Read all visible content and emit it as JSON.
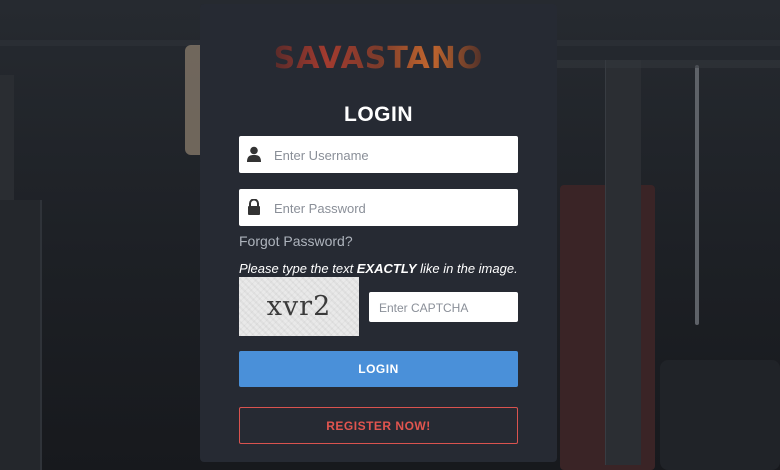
{
  "brand": {
    "logo_text": "SAVASTANO"
  },
  "form": {
    "title": "LOGIN",
    "username_placeholder": "Enter Username",
    "password_placeholder": "Enter Password",
    "forgot_password": "Forgot Password?",
    "captcha_instruction_prefix": "Please type the text ",
    "captcha_instruction_emphasis": "EXACTLY",
    "captcha_instruction_suffix": " like in the image.",
    "captcha_image_text": "xvr2",
    "captcha_placeholder": "Enter CAPTCHA",
    "login_button": "LOGIN",
    "register_button": "REGISTER NOW!"
  },
  "icons": {
    "username": "user-icon",
    "password": "lock-icon"
  },
  "colors": {
    "card_background": "#262a33",
    "login_button": "#4a90d9",
    "register_border": "#d9534f",
    "page_background": "#1c1e23"
  }
}
